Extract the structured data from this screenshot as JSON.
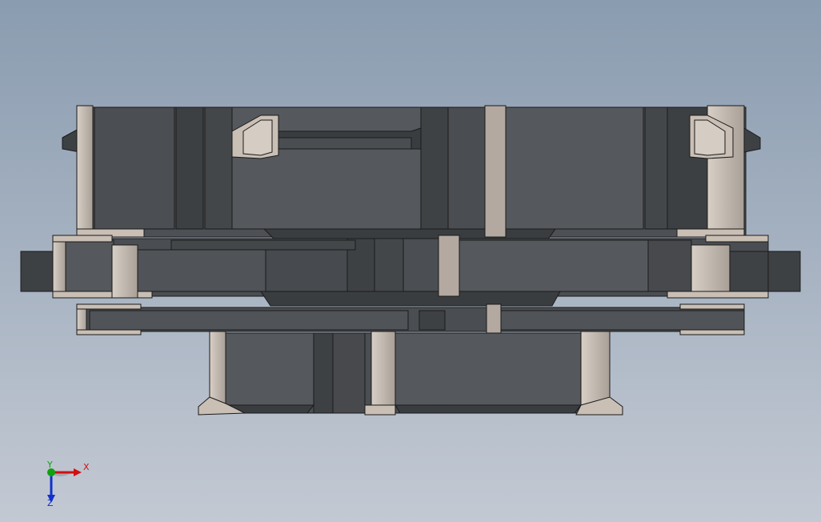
{
  "viewport": {
    "background_top": "#8a9cb0",
    "background_bottom": "#c3c9d3"
  },
  "model": {
    "body_dark": "#4b4e52",
    "body_mid": "#5b5e62",
    "body_light": "#6a6d71",
    "edge": "#1a1a1a",
    "clip_light": "#c9bfb5",
    "clip_mid": "#b0a79e",
    "clip_dark": "#8f8780"
  },
  "triad": {
    "x_label": "X",
    "y_label": "Y",
    "z_label": "Z",
    "x_color": "#d01010",
    "y_color": "#10a010",
    "z_color": "#1030d0"
  }
}
